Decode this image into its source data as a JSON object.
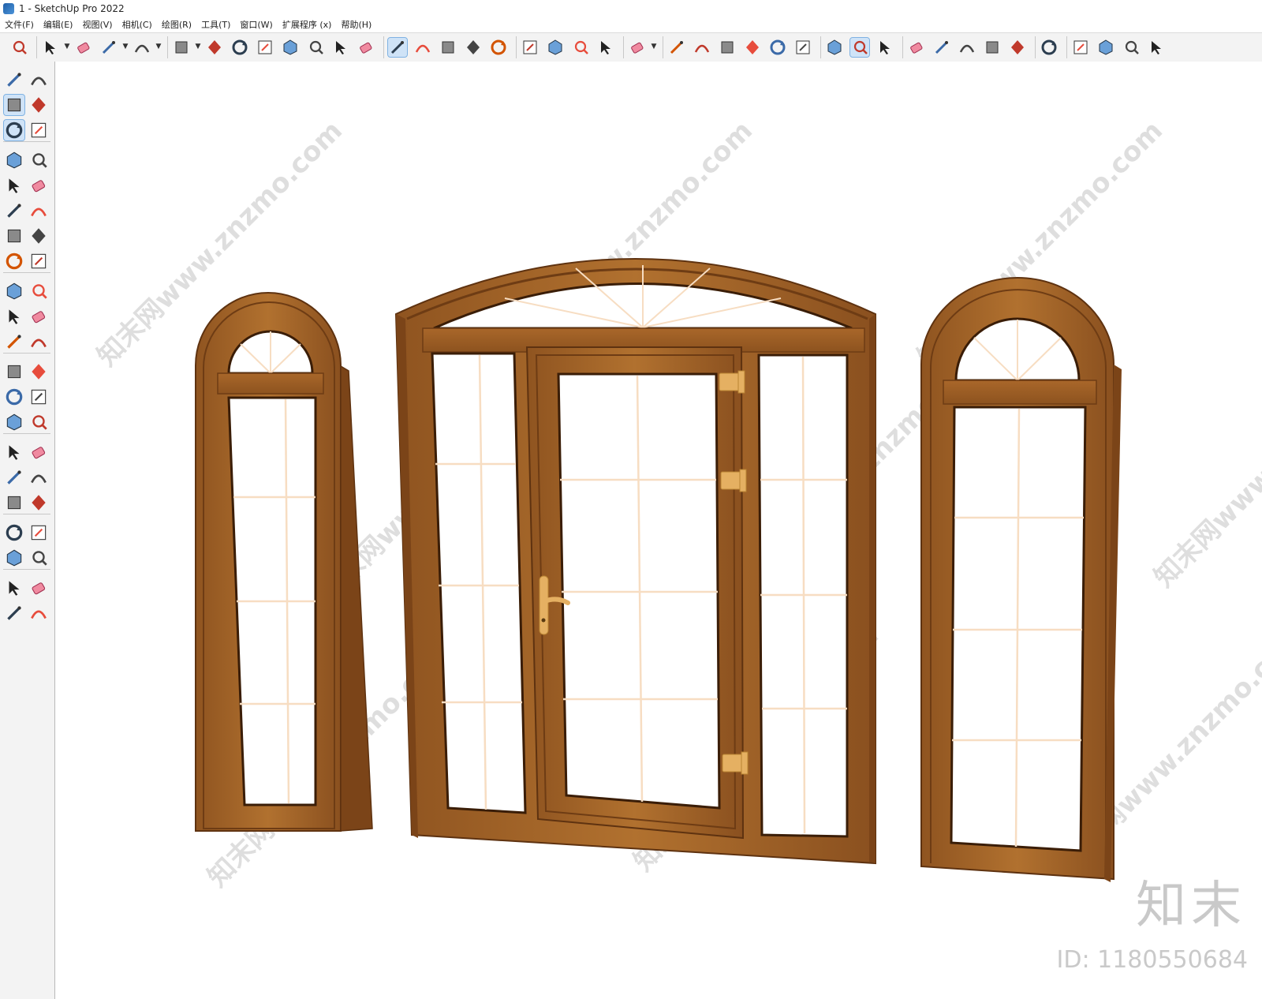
{
  "window": {
    "title": "1 - SketchUp Pro 2022"
  },
  "menu": [
    "文件(F)",
    "编辑(E)",
    "视图(V)",
    "相机(C)",
    "绘图(R)",
    "工具(T)",
    "窗口(W)",
    "扩展程序 (x)",
    "帮助(H)"
  ],
  "toolbar": {
    "icons": [
      "zoom-icon",
      "select-icon",
      "eraser-icon",
      "pencil-line-icon",
      "arc-icon",
      "rectangle-icon",
      "push-pull-icon",
      "follow-me-icon",
      "move-icon",
      "rotate-icon",
      "scale-icon",
      "tape-measure-icon",
      "text-label-icon",
      "paint-bucket-icon",
      "orbit-icon",
      "pan-icon",
      "zoom-tool-icon",
      "zoom-extents-icon",
      "3d-warehouse-icon",
      "extension-warehouse-icon",
      "layout-icon",
      "extension-manager-icon",
      "account-icon",
      "iso-view-icon",
      "top-view-icon",
      "front-view-icon",
      "right-view-icon",
      "back-view-icon",
      "left-view-icon",
      "section-plane-icon",
      "section-fill-icon",
      "section-display-icon",
      "add-location-icon",
      "terrain-icon",
      "styles-icon",
      "materials-icon",
      "cloud-upload-icon",
      "settings-icon",
      "components-icon",
      "info-icon",
      "cart-icon",
      "user-icon"
    ],
    "active": [
      "paint-bucket-icon",
      "section-fill-icon"
    ]
  },
  "left_toolbar": {
    "icons": [
      "select-icon",
      "orbit-small-icon",
      "paint-bucket-icon",
      "eraser-icon",
      "component-icon",
      "tag-icon",
      "pencil-line-icon",
      "freehand-icon",
      "rectangle-icon",
      "rotated-rectangle-icon",
      "circle-icon",
      "polygon-icon",
      "arc-icon",
      "two-point-arc-icon",
      "three-point-arc-icon",
      "pie-icon",
      "move-icon",
      "push-pull-icon",
      "rotate-icon",
      "follow-me-icon",
      "scale-icon",
      "offset-icon",
      "tape-measure-icon",
      "dimension-icon",
      "protractor-icon",
      "text-icon",
      "axes-icon",
      "3d-text-icon",
      "orbit-icon",
      "pan-icon",
      "zoom-icon",
      "zoom-window-icon",
      "zoom-extents-icon",
      "previous-view-icon",
      "position-camera-icon",
      "look-around-icon",
      "walk-icon",
      "section-plane-icon",
      "warehouse-icon",
      "extension-icon",
      "layout-icon",
      "extension-manager-icon"
    ],
    "active": [
      "paint-bucket-icon",
      "component-icon"
    ]
  },
  "viewport": {
    "watermark_text": "知末网www.znzmo.com",
    "brand": "知末",
    "model_id": "ID: 1180550684",
    "colors": {
      "wood": "#a9672a",
      "wood_dark": "#6e3c14",
      "glass": "#ffffff",
      "muntin": "#f7ddc2",
      "hardware": "#e5b062"
    }
  }
}
